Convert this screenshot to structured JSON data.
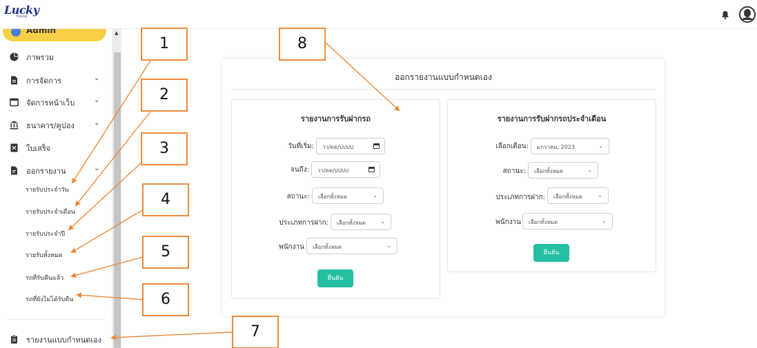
{
  "header": {
    "logo_text": "Lucky",
    "logo_sub": "Parking",
    "bell_icon": "bell-icon",
    "avatar_icon": "user-avatar-icon"
  },
  "sidebar": {
    "admin_label": "Admin",
    "items": [
      {
        "label": "ภาพรวม",
        "icon": "pie-chart-icon",
        "has_chevron": false
      },
      {
        "label": "การจัดการ",
        "icon": "file-icon",
        "has_chevron": true
      },
      {
        "label": "จัดการหน้าเว็บ",
        "icon": "window-icon",
        "has_chevron": true
      },
      {
        "label": "ธนาคาร/คูปอง",
        "icon": "bank-icon",
        "has_chevron": true
      },
      {
        "label": "ใบเสร็จ",
        "icon": "receipt-icon",
        "has_chevron": false
      },
      {
        "label": "ออกรายงาน",
        "icon": "report-icon",
        "has_chevron": true
      }
    ],
    "sub_items": [
      "รายรับประจำวัน",
      "รายรับประจำเดือน",
      "รายรับประจำปี",
      "รายรับทั้งหมด",
      "รถที่รับคืนแล้ว",
      "รถที่ยังไม่ได้รับคืน"
    ],
    "bottom_item": {
      "label": "รายงานแบบกำหนดเอง",
      "icon": "clipboard-icon"
    }
  },
  "main": {
    "title": "ออกรายงานแบบกำหนดเอง",
    "left_panel": {
      "title": "รายงานการรับฝากรถ",
      "start_label": "วันที่เริ่ม:",
      "start_value": "วว/ดด/ปปปป",
      "end_label": "จนถึง:",
      "end_value": "วว/ดด/ปปปป",
      "status_label": "สถานะ:",
      "status_value": "เลือกทั้งหมด",
      "type_label": "ประเภทการฝาก:",
      "type_value": "เลือกทั้งหมด",
      "staff_label": "พนักงาน",
      "staff_value": "เลือกทั้งหมด",
      "confirm_label": "ยืนยัน"
    },
    "right_panel": {
      "title": "รายงานการรับฝากรถประจำเดือน",
      "month_label": "เลือกเดือน:",
      "month_value": "มกราคม, 2023",
      "status_label": "สถานะ:",
      "status_value": "เลือกทั้งหมด",
      "type_label": "ประเภทการฝาก:",
      "type_value": "เลือกทั้งหมด",
      "staff_label": "พนักงาน",
      "staff_value": "เลือกทั้งหมด",
      "confirm_label": "ยืนยัน"
    }
  },
  "annotations": [
    "1",
    "2",
    "3",
    "4",
    "5",
    "6",
    "7",
    "8"
  ],
  "colors": {
    "accent": "#24bfa0",
    "admin_pill": "#f7d046",
    "annotation": "#ee8a3a",
    "brand": "#1d2f86"
  }
}
